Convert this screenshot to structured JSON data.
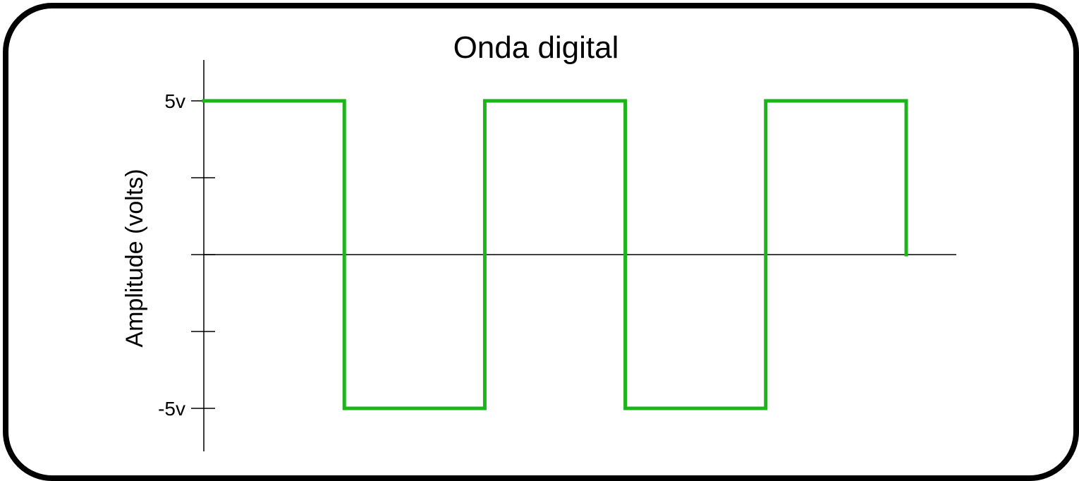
{
  "chart_data": {
    "type": "line",
    "title": "Onda digital",
    "xlabel": "",
    "ylabel": "Amplitude (volts)",
    "ylim": [
      -5,
      5
    ],
    "yticks": [
      -5,
      -2.5,
      0,
      2.5,
      5
    ],
    "ytick_labels": [
      {
        "value": 5,
        "label": "5v"
      },
      {
        "value": -5,
        "label": "-5v"
      }
    ],
    "xlim": [
      0,
      10
    ],
    "grid": false,
    "series": [
      {
        "color": "#1db31d",
        "step": true,
        "x": [
          0,
          2,
          2,
          4,
          4,
          6,
          6,
          8,
          8,
          10,
          10
        ],
        "y": [
          5,
          5,
          -5,
          -5,
          5,
          5,
          -5,
          -5,
          5,
          5,
          0
        ]
      }
    ]
  }
}
